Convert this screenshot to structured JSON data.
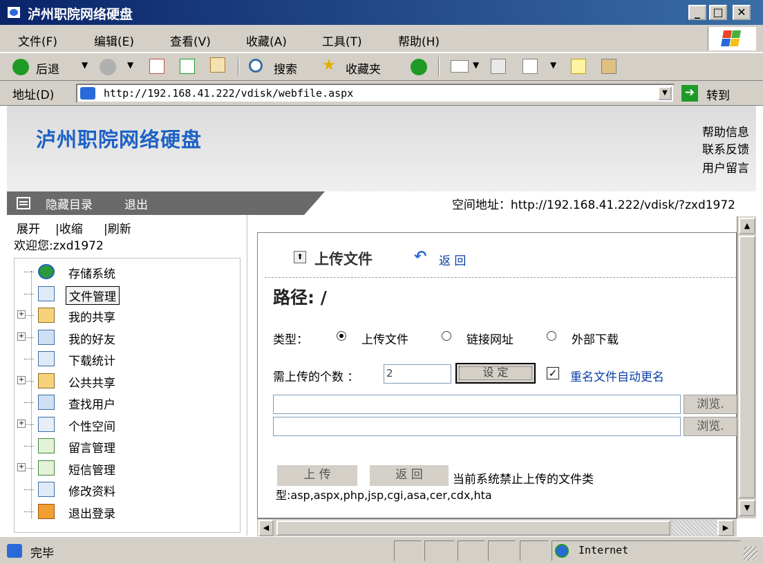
{
  "window": {
    "title": "泸州职院网络硬盘"
  },
  "menu": [
    "文件(F)",
    "编辑(E)",
    "查看(V)",
    "收藏(A)",
    "工具(T)",
    "帮助(H)"
  ],
  "toolbar": {
    "back": "后退",
    "search": "搜索",
    "favorites": "收藏夹"
  },
  "address": {
    "label": "地址(D)",
    "url": "http://192.168.41.222/vdisk/webfile.aspx",
    "go": "转到"
  },
  "header": {
    "site_title": "泸州职院网络硬盘",
    "links": [
      "帮助信息",
      "联系反馈",
      "用户留言"
    ]
  },
  "nav": {
    "hide_dir": "隐藏目录",
    "logout": "退出",
    "space_addr": "空间地址：http://192.168.41.222/vdisk/?zxd1972"
  },
  "left": {
    "expand": "展开",
    "collapse": "|收缩",
    "refresh": "|刷新",
    "welcome": "欢迎您:zxd1972",
    "tree": [
      {
        "label": "存储系统",
        "icon": "globe",
        "expandable": false,
        "selected": false
      },
      {
        "label": "文件管理",
        "icon": "folder",
        "expandable": false,
        "selected": true
      },
      {
        "label": "我的共享",
        "icon": "share",
        "expandable": true,
        "selected": false
      },
      {
        "label": "我的好友",
        "icon": "user",
        "expandable": true,
        "selected": false
      },
      {
        "label": "下载统计",
        "icon": "folder",
        "expandable": false,
        "selected": false
      },
      {
        "label": "公共共享",
        "icon": "share",
        "expandable": true,
        "selected": false
      },
      {
        "label": "查找用户",
        "icon": "user",
        "expandable": false,
        "selected": false
      },
      {
        "label": "个性空间",
        "icon": "search",
        "expandable": true,
        "selected": false
      },
      {
        "label": "留言管理",
        "icon": "doc",
        "expandable": false,
        "selected": false
      },
      {
        "label": "短信管理",
        "icon": "doc",
        "expandable": true,
        "selected": false
      },
      {
        "label": "修改资料",
        "icon": "folder",
        "expandable": false,
        "selected": false
      },
      {
        "label": "退出登录",
        "icon": "exit",
        "expandable": false,
        "selected": false
      }
    ]
  },
  "main": {
    "upload_title": "上传文件",
    "return_link": "返 回",
    "path_label": "路径: /",
    "type_label": "类型：",
    "types": [
      {
        "label": "上传文件",
        "checked": true
      },
      {
        "label": "链接网址",
        "checked": false
      },
      {
        "label": "外部下载",
        "checked": false
      }
    ],
    "count_label": "需上传的个数 ：",
    "count_value": "2",
    "set_button": "设  定",
    "rename_label": "重名文件自动更名",
    "rename_checked": true,
    "browse": "浏览.",
    "upload_btn": "上  传",
    "back_btn": "返  回",
    "forbidden_text": "当前系统禁止上传的文件类",
    "forbidden_types": "型:asp,aspx,php,jsp,cgi,asa,cer,cdx,hta"
  },
  "status": {
    "done": "完毕",
    "zone": "Internet"
  },
  "colors": {
    "title_blue": "#1d61c6",
    "link_blue": "#0a3ea8",
    "nav_dark": "#6a6a6a"
  }
}
